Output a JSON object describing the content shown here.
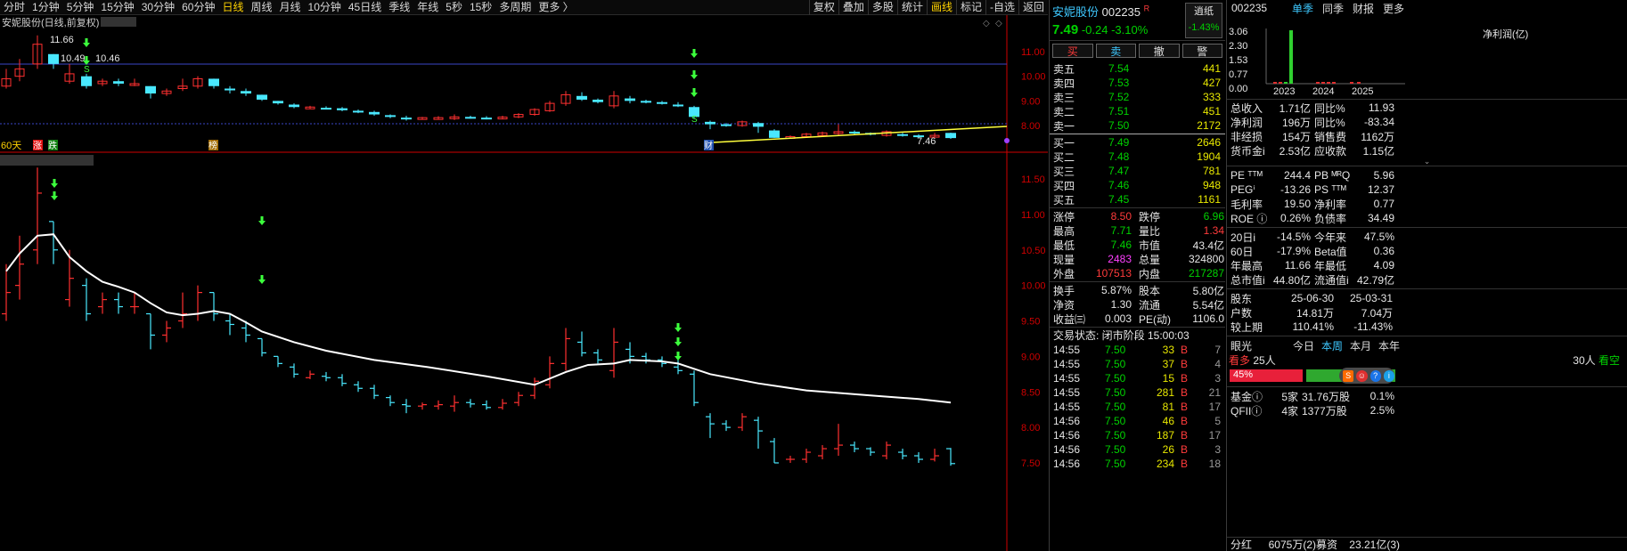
{
  "toolbar": {
    "left": [
      {
        "label": "分时",
        "active": false
      },
      {
        "label": "1分钟",
        "active": false
      },
      {
        "label": "5分钟",
        "active": false
      },
      {
        "label": "15分钟",
        "active": false
      },
      {
        "label": "30分钟",
        "active": false
      },
      {
        "label": "60分钟",
        "active": false
      },
      {
        "label": "日线",
        "active": true
      },
      {
        "label": "周线",
        "active": false
      },
      {
        "label": "月线",
        "active": false
      },
      {
        "label": "10分钟",
        "active": false
      },
      {
        "label": "45日线",
        "active": false
      },
      {
        "label": "季线",
        "active": false
      },
      {
        "label": "年线",
        "active": false
      },
      {
        "label": "5秒",
        "active": false
      },
      {
        "label": "15秒",
        "active": false
      },
      {
        "label": "多周期",
        "active": false
      },
      {
        "label": "更多 〉",
        "active": false
      }
    ],
    "right": [
      {
        "label": "复权",
        "hl": false
      },
      {
        "label": "叠加",
        "hl": false
      },
      {
        "label": "多股",
        "hl": false
      },
      {
        "label": "统计",
        "hl": false
      },
      {
        "label": "画线",
        "hl": true
      },
      {
        "label": "标记",
        "hl": false
      },
      {
        "label": "-自选",
        "hl": false
      },
      {
        "label": "返回",
        "hl": false
      }
    ]
  },
  "upper_chart": {
    "title": "安妮股份(日线,前复权)",
    "y_ticks": [
      "11.00",
      "10.00",
      "9.00",
      "8.00"
    ],
    "annotations": {
      "high": "11.66",
      "a": "10.49",
      "b": "10.46",
      "low": "7.46"
    },
    "markers": [
      "60天",
      "涨",
      "跌",
      "榜",
      "财"
    ]
  },
  "lower_chart": {
    "y_ticks": [
      "11.50",
      "11.00",
      "10.50",
      "10.00",
      "9.50",
      "9.00",
      "8.50",
      "8.00",
      "7.50"
    ]
  },
  "colors": {
    "up": "#ff3030",
    "down": "#49e8ff",
    "ma": "#ffffff",
    "arrow": "#3cff3c",
    "trend": "#ffff3c",
    "axis": "#d00000"
  },
  "quote": {
    "name": "安妮股份",
    "code": "002235",
    "flag": "R",
    "price": "7.49",
    "change": "-0.24",
    "pct": "-3.10%",
    "btn_label": "逍纸",
    "btn_pct": "-1.43%",
    "actions": [
      "买",
      "卖",
      "撤",
      "警"
    ],
    "asks": [
      {
        "label": "卖五",
        "price": "7.54",
        "vol": "441"
      },
      {
        "label": "卖四",
        "price": "7.53",
        "vol": "427"
      },
      {
        "label": "卖三",
        "price": "7.52",
        "vol": "333"
      },
      {
        "label": "卖二",
        "price": "7.51",
        "vol": "451"
      },
      {
        "label": "卖一",
        "price": "7.50",
        "vol": "2172"
      }
    ],
    "bids": [
      {
        "label": "买一",
        "price": "7.49",
        "vol": "2646"
      },
      {
        "label": "买二",
        "price": "7.48",
        "vol": "1904"
      },
      {
        "label": "买三",
        "price": "7.47",
        "vol": "781"
      },
      {
        "label": "买四",
        "price": "7.46",
        "vol": "948"
      },
      {
        "label": "买五",
        "price": "7.45",
        "vol": "1161"
      }
    ],
    "stats1": [
      [
        "涨停",
        "8.50",
        "跌停",
        "6.96"
      ],
      [
        "最高",
        "7.71",
        "量比",
        "1.34"
      ],
      [
        "最低",
        "7.46",
        "市值",
        "43.4亿"
      ],
      [
        "现量",
        "2483",
        "总量",
        "324800"
      ],
      [
        "外盘",
        "107513",
        "内盘",
        "217287"
      ]
    ],
    "stats2": [
      [
        "换手",
        "5.87%",
        "股本",
        "5.80亿"
      ],
      [
        "净资",
        "1.30",
        "流通",
        "5.54亿"
      ],
      [
        "收益㈢",
        "0.003",
        "PE(动)",
        "1106.0"
      ]
    ],
    "trade_status": "交易状态: 闭市阶段 15:00:03",
    "ticks": [
      [
        "14:55",
        "7.50",
        "33",
        "B",
        "7"
      ],
      [
        "14:55",
        "7.50",
        "37",
        "B",
        "4"
      ],
      [
        "14:55",
        "7.50",
        "15",
        "B",
        "3"
      ],
      [
        "14:55",
        "7.50",
        "281",
        "B",
        "21"
      ],
      [
        "14:55",
        "7.50",
        "81",
        "B",
        "17"
      ],
      [
        "14:56",
        "7.50",
        "46",
        "B",
        "5"
      ],
      [
        "14:56",
        "7.50",
        "187",
        "B",
        "17"
      ],
      [
        "14:56",
        "7.50",
        "26",
        "B",
        "3"
      ],
      [
        "14:56",
        "7.50",
        "234",
        "B",
        "18"
      ]
    ]
  },
  "fundamentals": {
    "code": "002235",
    "tabs": [
      "单季",
      "同季",
      "财报",
      "更多"
    ],
    "chart_label": "净利润(亿)",
    "y_ticks": [
      "3.06",
      "2.30",
      "1.53",
      "0.77",
      "0.00"
    ],
    "years": [
      "2023",
      "2024",
      "2025"
    ],
    "rows1": [
      [
        "总收入",
        "1.71亿",
        "同比%",
        "11.93"
      ],
      [
        "净利润",
        "196万",
        "同比%",
        "-83.34"
      ],
      [
        "非经损",
        "154万",
        "销售费",
        "1162万"
      ],
      [
        "货币金i",
        "2.53亿",
        "应收款",
        "1.15亿"
      ]
    ],
    "rows2": [
      [
        "PE ᵀᵀᴹ",
        "244.4",
        "PB ᴹᴿQ",
        "5.96"
      ],
      [
        "PEGⁱ",
        "-13.26",
        "PS ᵀᵀᴹ",
        "12.37"
      ],
      [
        "毛利率",
        "19.50",
        "净利率",
        "0.77"
      ],
      [
        "ROE ⓘ",
        "0.26%",
        "负债率",
        "34.49"
      ]
    ],
    "rows3": [
      [
        "20日i",
        "-14.5%",
        "今年来",
        "47.5%"
      ],
      [
        "60日",
        "-17.9%",
        "Beta值",
        "0.36"
      ],
      [
        "年最高",
        "11.66",
        "年最低",
        "4.09"
      ],
      [
        "总市值i",
        "44.80亿",
        "流通值i",
        "42.79亿"
      ]
    ],
    "rows4": [
      [
        "股东",
        "25-06-30",
        "25-03-31"
      ],
      [
        "户数",
        "14.81万",
        "7.04万"
      ],
      [
        "较上期",
        "110.41%",
        "-11.43%"
      ]
    ],
    "vision": {
      "label": "眼光",
      "tabs": [
        "今日",
        "本周",
        "本月",
        "本年"
      ],
      "active": "本周",
      "bear": "看多",
      "bear_count": "25人",
      "bull_count": "30人",
      "bull": "看空",
      "pct": "45%"
    },
    "holders": [
      [
        "基金ⓘ",
        "5家",
        "31.76万股",
        "0.1%"
      ],
      [
        "QFIIⓘ",
        "4家",
        "1377万股",
        "2.5%"
      ]
    ],
    "bottom": [
      "分红",
      "6075万(2)",
      "募资",
      "23.21亿(3)"
    ]
  }
}
